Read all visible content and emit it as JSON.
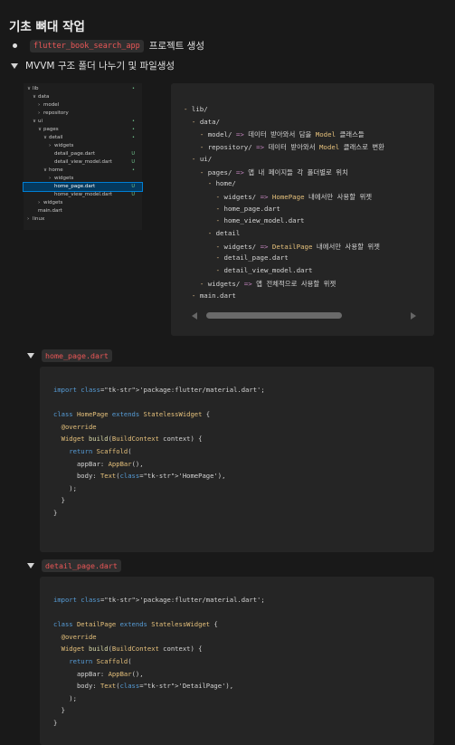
{
  "title": "기초 뼈대 작업",
  "bullet": {
    "code": "flutter_book_search_app",
    "text": "프로젝트 생성"
  },
  "toggle_main": {
    "label": "MVVM 구조 폴더 나누기 및 파일생성"
  },
  "explorer": {
    "rows": [
      {
        "label": "lib",
        "chev": "∨",
        "badge": "•"
      },
      {
        "label": "data",
        "chev": "∨",
        "badge": ""
      },
      {
        "label": "model",
        "chev": "›",
        "badge": ""
      },
      {
        "label": "repository",
        "chev": "›",
        "badge": ""
      },
      {
        "label": "ui",
        "chev": "∨",
        "badge": "•"
      },
      {
        "label": "pages",
        "chev": "∨",
        "badge": "•"
      },
      {
        "label": "detail",
        "chev": "∨",
        "badge": "•"
      },
      {
        "label": "widgets",
        "chev": "›",
        "badge": ""
      },
      {
        "label": "detail_page.dart",
        "chev": "",
        "badge": "U"
      },
      {
        "label": "detail_view_model.dart",
        "chev": "",
        "badge": "U"
      },
      {
        "label": "home",
        "chev": "∨",
        "badge": "•"
      },
      {
        "label": "widgets",
        "chev": "›",
        "badge": ""
      },
      {
        "label": "home_page.dart",
        "chev": "",
        "badge": "U"
      },
      {
        "label": "home_view_model.dart",
        "chev": "",
        "badge": "U"
      },
      {
        "label": "widgets",
        "chev": "›",
        "badge": ""
      },
      {
        "label": "main.dart",
        "chev": "",
        "badge": ""
      },
      {
        "label": "linux",
        "chev": "›",
        "badge": ""
      }
    ]
  },
  "tree": {
    "lines": [
      "- lib/",
      "  - data/",
      "    - model/ => 데이터 받아와서 담을 Model 클래스들",
      "    - repository/ => 데이터 받아와서 Model 클래스로 변환",
      "  - ui/",
      "    - pages/ => 앱 내 페이지들 각 폴더별로 위치",
      "      - home/",
      "        - widgets/ => HomePage 내에서만 사용할 위젯",
      "        - home_page.dart",
      "        - home_view_model.dart",
      "      - detail",
      "        - widgets/ => DetailPage 내에서만 사용할 위젯",
      "        - detail_page.dart",
      "        - detail_view_model.dart",
      "    - widgets/ => 앱 전체적으로 사용할 위젯",
      "  - main.dart"
    ]
  },
  "home_block": {
    "label": "home_page.dart",
    "code": [
      "import 'package:flutter/material.dart';",
      "",
      "class HomePage extends StatelessWidget {",
      "  @override",
      "  Widget build(BuildContext context) {",
      "    return Scaffold(",
      "      appBar: AppBar(),",
      "      body: Text('HomePage'),",
      "    );",
      "  }",
      "}"
    ]
  },
  "detail_block": {
    "label": "detail_page.dart",
    "code": [
      "import 'package:flutter/material.dart';",
      "",
      "class DetailPage extends StatelessWidget {",
      "  @override",
      "  Widget build(BuildContext context) {",
      "    return Scaffold(",
      "      appBar: AppBar(),",
      "      body: Text('DetailPage'),",
      "    );",
      "  }",
      "}"
    ]
  }
}
